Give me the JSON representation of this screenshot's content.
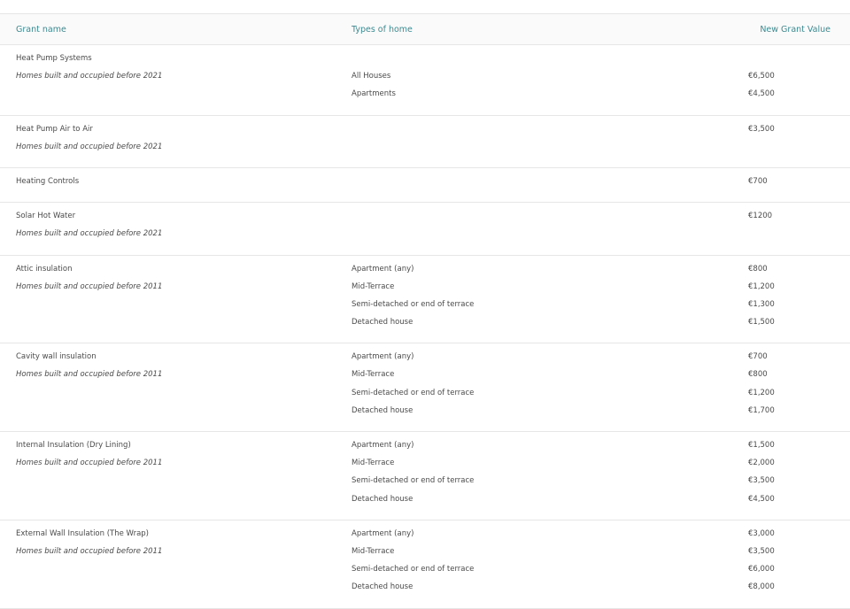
{
  "columns": {
    "name": "Grant name",
    "type": "Types of home",
    "value": "New Grant Value"
  },
  "groups": [
    {
      "name": "Heat Pump Systems",
      "note": "Homes built and occupied before 2021",
      "rows": [
        {
          "type": "",
          "value": ""
        },
        {
          "type": "All Houses",
          "value": "€6,500"
        },
        {
          "type": "Apartments",
          "value": "€4,500"
        }
      ]
    },
    {
      "name": "Heat Pump Air to Air",
      "note": "Homes built and occupied before 2021",
      "rows": [
        {
          "type": "",
          "value": "€3,500"
        },
        {
          "type": "",
          "value": ""
        }
      ]
    },
    {
      "name": "Heating Controls",
      "note": "",
      "rows": [
        {
          "type": "",
          "value": "€700"
        }
      ]
    },
    {
      "name": "Solar Hot Water",
      "note": "Homes built and occupied before 2021",
      "rows": [
        {
          "type": "",
          "value": "€1200"
        },
        {
          "type": "",
          "value": ""
        }
      ]
    },
    {
      "name": "Attic insulation",
      "note": "Homes built and occupied before 2011",
      "rows": [
        {
          "type": "Apartment (any)",
          "value": "€800"
        },
        {
          "type": "Mid-Terrace",
          "value": "€1,200"
        },
        {
          "type": "Semi-detached or end of terrace",
          "value": "€1,300"
        },
        {
          "type": "Detached house",
          "value": "€1,500"
        }
      ]
    },
    {
      "name": "Cavity wall insulation",
      "note": "Homes built and occupied before 2011",
      "rows": [
        {
          "type": "Apartment (any)",
          "value": "€700"
        },
        {
          "type": "Mid-Terrace",
          "value": "€800"
        },
        {
          "type": "Semi-detached or end of terrace",
          "value": "€1,200"
        },
        {
          "type": "Detached house",
          "value": "€1,700"
        }
      ]
    },
    {
      "name": "Internal Insulation (Dry Lining)",
      "note": "Homes built and occupied before 2011",
      "rows": [
        {
          "type": "Apartment (any)",
          "value": "€1,500"
        },
        {
          "type": "Mid-Terrace",
          "value": "€2,000"
        },
        {
          "type": "Semi-detached or end of terrace",
          "value": "€3,500"
        },
        {
          "type": "Detached house",
          "value": "€4,500"
        }
      ]
    },
    {
      "name": "External Wall Insulation (The Wrap)",
      "note": "Homes built and occupied before 2011",
      "rows": [
        {
          "type": "Apartment (any)",
          "value": "€3,000"
        },
        {
          "type": "Mid-Terrace",
          "value": "€3,500"
        },
        {
          "type": "Semi-detached or end of terrace",
          "value": "€6,000"
        },
        {
          "type": "Detached house",
          "value": "€8,000"
        }
      ]
    }
  ]
}
